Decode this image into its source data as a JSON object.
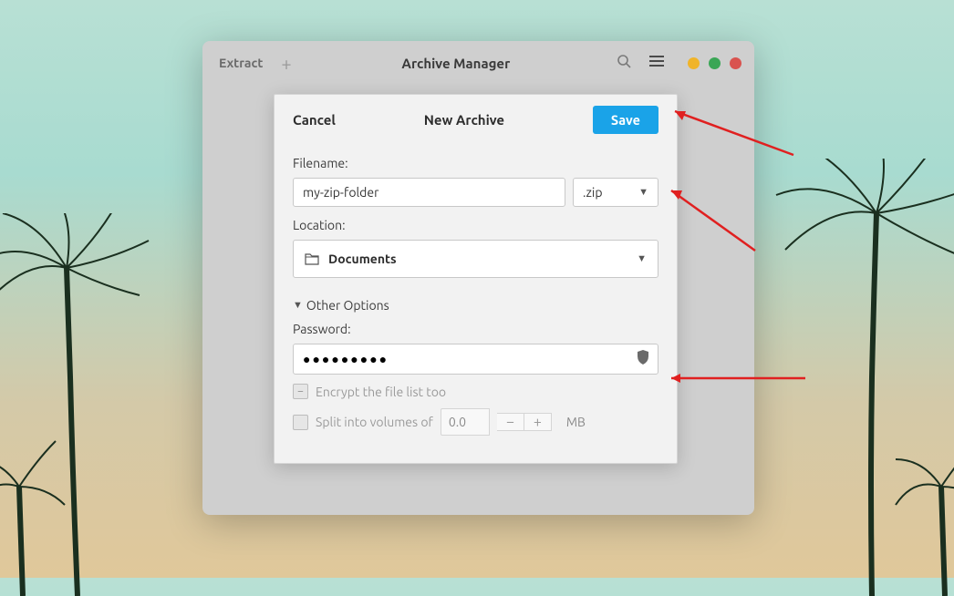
{
  "window": {
    "extract_label": "Extract",
    "title": "Archive Manager"
  },
  "dialog": {
    "cancel_label": "Cancel",
    "title": "New Archive",
    "save_label": "Save",
    "filename_label": "Filename:",
    "filename_value": "my-zip-folder",
    "extension_value": ".zip",
    "location_label": "Location:",
    "location_value": "Documents",
    "other_options_label": "Other Options",
    "password_label": "Password:",
    "password_value": "●●●●●●●●●",
    "encrypt_label": "Encrypt the file list too",
    "split_label": "Split into volumes of",
    "split_value": "0.0",
    "split_unit": "MB"
  }
}
